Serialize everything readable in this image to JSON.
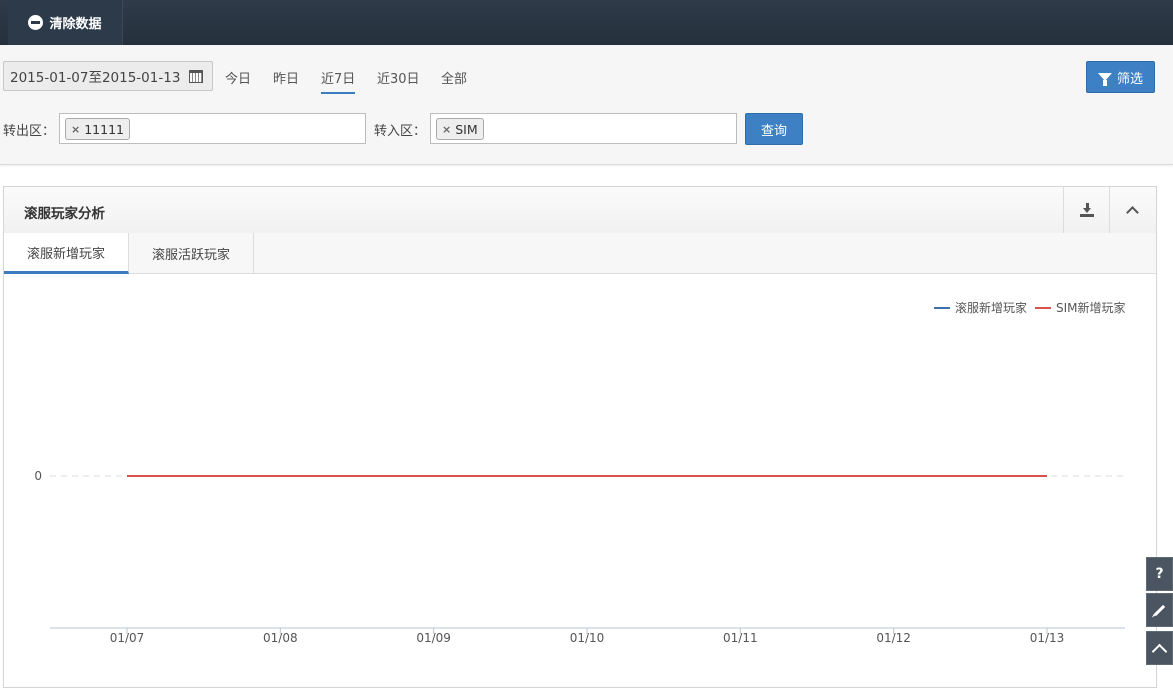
{
  "topbar": {
    "clear_label": "清除数据"
  },
  "filters": {
    "date_range": "2015-01-07至2015-01-13",
    "ranges": [
      "今日",
      "昨日",
      "近7日",
      "近30日",
      "全部"
    ],
    "active_range": "近7日",
    "filter_button": "筛选",
    "from_zone_label": "转出区：",
    "from_zone_tag": "11111",
    "to_zone_label": "转入区：",
    "to_zone_tag": "SIM",
    "query_button": "查询"
  },
  "panel": {
    "title": "滚服玩家分析",
    "tabs": [
      "滚服新增玩家",
      "滚服活跃玩家"
    ],
    "active_tab": "滚服新增玩家"
  },
  "side_buttons": {
    "help_label": "?"
  },
  "chart_data": {
    "type": "line",
    "categories": [
      "01/07",
      "01/08",
      "01/09",
      "01/10",
      "01/11",
      "01/12",
      "01/13"
    ],
    "series": [
      {
        "name": "滚服新增玩家",
        "values": [
          0,
          0,
          0,
          0,
          0,
          0,
          0
        ],
        "color": "#3d6fa8"
      },
      {
        "name": "SIM新增玩家",
        "values": [
          0,
          0,
          0,
          0,
          0,
          0,
          0
        ],
        "color": "#d9534f"
      }
    ],
    "yticks": [
      0
    ],
    "legend": "top-right",
    "grid": true
  }
}
